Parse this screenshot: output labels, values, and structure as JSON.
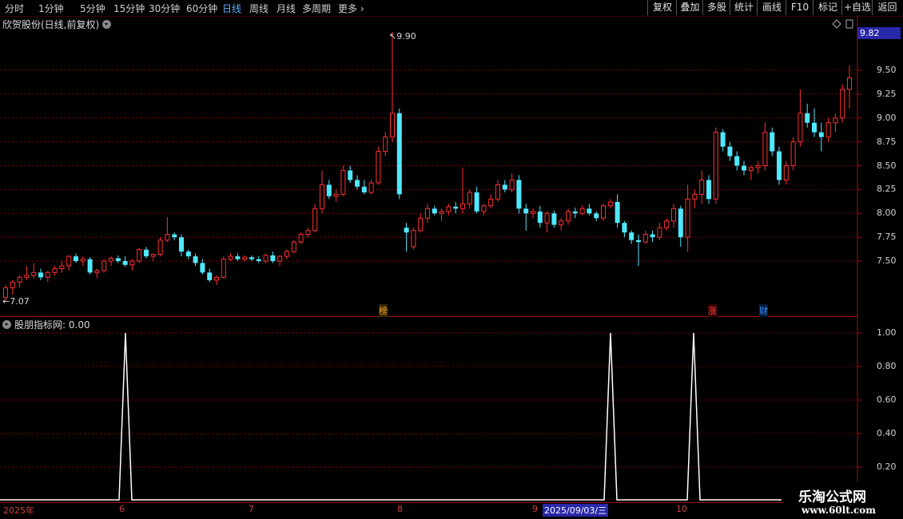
{
  "toolbar": {
    "timeframes": [
      "分时",
      "1分钟",
      "5分钟",
      "15分钟",
      "30分钟",
      "60分钟",
      "日线",
      "周线",
      "月线",
      "多周期",
      "更多"
    ],
    "active_timeframe": "日线",
    "right_buttons": [
      "复权",
      "叠加",
      "多股",
      "统计",
      "画线",
      "F10",
      "标记",
      "+自选",
      "返回"
    ]
  },
  "main_panel": {
    "title": "欣贺股份(日线,前复权)",
    "current_price_tag": "9.82",
    "high_label": "9.90",
    "low_label": "7.07",
    "y_ticks": [
      "9.50",
      "9.25",
      "9.00",
      "8.75",
      "8.50",
      "8.25",
      "8.00",
      "7.75",
      "7.50"
    ],
    "markers": [
      {
        "text": "榜",
        "color": "#e8a030"
      },
      {
        "text": "涨",
        "color": "#ff4040"
      },
      {
        "text": "财",
        "color": "#4090ff"
      }
    ]
  },
  "indicator_panel": {
    "title": "股朋指标网",
    "value_text": ": 0.00",
    "y_ticks": [
      "1.00",
      "0.80",
      "0.60",
      "0.40",
      "0.20"
    ],
    "signals": [
      1,
      0,
      0,
      1,
      1
    ]
  },
  "date_axis": {
    "labels": [
      "2025年",
      "6",
      "7",
      "8",
      "9",
      "10"
    ],
    "cursor_date": "2025/09/03/三"
  },
  "watermark": {
    "line1": "乐淘公式网",
    "line2": "www.60lt.com"
  },
  "colors": {
    "up": "#ff3030",
    "down": "#50e8ff",
    "grid": "#7a0000",
    "axis": "#a01010"
  },
  "chart_data": {
    "type": "candlestick",
    "title": "欣贺股份(日线,前复权)",
    "ylim": [
      7.0,
      10.0
    ],
    "notes": "Daily OHLC values estimated from chart; up = red hollow, down = cyan filled",
    "ohlc": [
      [
        7.12,
        7.25,
        7.07,
        7.22
      ],
      [
        7.22,
        7.3,
        7.15,
        7.28
      ],
      [
        7.28,
        7.35,
        7.22,
        7.33
      ],
      [
        7.33,
        7.45,
        7.3,
        7.35
      ],
      [
        7.35,
        7.48,
        7.32,
        7.38
      ],
      [
        7.38,
        7.42,
        7.3,
        7.33
      ],
      [
        7.33,
        7.4,
        7.28,
        7.38
      ],
      [
        7.38,
        7.45,
        7.35,
        7.42
      ],
      [
        7.42,
        7.5,
        7.38,
        7.45
      ],
      [
        7.45,
        7.56,
        7.4,
        7.55
      ],
      [
        7.55,
        7.58,
        7.48,
        7.5
      ],
      [
        7.5,
        7.55,
        7.45,
        7.52
      ],
      [
        7.52,
        7.54,
        7.36,
        7.38
      ],
      [
        7.38,
        7.42,
        7.32,
        7.4
      ],
      [
        7.4,
        7.52,
        7.38,
        7.5
      ],
      [
        7.5,
        7.55,
        7.45,
        7.53
      ],
      [
        7.53,
        7.56,
        7.48,
        7.5
      ],
      [
        7.5,
        7.55,
        7.44,
        7.46
      ],
      [
        7.46,
        7.52,
        7.4,
        7.5
      ],
      [
        7.5,
        7.64,
        7.48,
        7.62
      ],
      [
        7.62,
        7.65,
        7.53,
        7.55
      ],
      [
        7.55,
        7.58,
        7.5,
        7.57
      ],
      [
        7.57,
        7.75,
        7.55,
        7.72
      ],
      [
        7.72,
        7.96,
        7.7,
        7.78
      ],
      [
        7.78,
        7.8,
        7.72,
        7.75
      ],
      [
        7.75,
        7.78,
        7.55,
        7.6
      ],
      [
        7.6,
        7.62,
        7.52,
        7.55
      ],
      [
        7.55,
        7.58,
        7.45,
        7.48
      ],
      [
        7.48,
        7.52,
        7.36,
        7.38
      ],
      [
        7.38,
        7.42,
        7.28,
        7.3
      ],
      [
        7.3,
        7.35,
        7.25,
        7.33
      ],
      [
        7.33,
        7.55,
        7.32,
        7.52
      ],
      [
        7.52,
        7.58,
        7.5,
        7.55
      ],
      [
        7.55,
        7.58,
        7.5,
        7.52
      ],
      [
        7.52,
        7.56,
        7.5,
        7.54
      ],
      [
        7.54,
        7.56,
        7.5,
        7.52
      ],
      [
        7.52,
        7.55,
        7.48,
        7.5
      ],
      [
        7.5,
        7.58,
        7.48,
        7.56
      ],
      [
        7.56,
        7.6,
        7.48,
        7.5
      ],
      [
        7.5,
        7.56,
        7.45,
        7.55
      ],
      [
        7.55,
        7.62,
        7.52,
        7.6
      ],
      [
        7.6,
        7.72,
        7.58,
        7.7
      ],
      [
        7.7,
        7.8,
        7.68,
        7.78
      ],
      [
        7.78,
        7.85,
        7.75,
        7.82
      ],
      [
        7.82,
        8.1,
        7.8,
        8.05
      ],
      [
        8.05,
        8.45,
        8.0,
        8.3
      ],
      [
        8.3,
        8.35,
        8.15,
        8.18
      ],
      [
        8.18,
        8.25,
        8.12,
        8.2
      ],
      [
        8.2,
        8.5,
        8.18,
        8.45
      ],
      [
        8.45,
        8.5,
        8.32,
        8.35
      ],
      [
        8.35,
        8.4,
        8.25,
        8.28
      ],
      [
        8.28,
        8.35,
        8.2,
        8.22
      ],
      [
        8.22,
        8.35,
        8.2,
        8.32
      ],
      [
        8.32,
        8.7,
        8.3,
        8.65
      ],
      [
        8.65,
        8.85,
        8.6,
        8.8
      ],
      [
        8.8,
        9.9,
        8.75,
        9.05
      ],
      [
        9.05,
        9.1,
        8.15,
        8.2
      ],
      [
        7.85,
        7.9,
        7.6,
        7.8
      ],
      [
        7.65,
        7.85,
        7.62,
        7.82
      ],
      [
        7.82,
        8.0,
        7.8,
        7.95
      ],
      [
        7.95,
        8.1,
        7.9,
        8.05
      ],
      [
        8.05,
        8.08,
        7.98,
        8.0
      ],
      [
        8.0,
        8.05,
        7.92,
        8.02
      ],
      [
        8.02,
        8.1,
        7.98,
        8.07
      ],
      [
        8.07,
        8.12,
        8.0,
        8.05
      ],
      [
        8.05,
        8.48,
        8.0,
        8.1
      ],
      [
        8.1,
        8.25,
        8.05,
        8.22
      ],
      [
        8.22,
        8.28,
        8.0,
        8.02
      ],
      [
        8.02,
        8.1,
        7.98,
        8.08
      ],
      [
        8.08,
        8.2,
        8.05,
        8.15
      ],
      [
        8.15,
        8.35,
        8.12,
        8.3
      ],
      [
        8.3,
        8.35,
        8.22,
        8.25
      ],
      [
        8.25,
        8.42,
        8.22,
        8.35
      ],
      [
        8.35,
        8.4,
        8.0,
        8.05
      ],
      [
        8.05,
        8.1,
        7.82,
        8.0
      ],
      [
        8.0,
        8.05,
        7.95,
        8.02
      ],
      [
        8.02,
        8.08,
        7.85,
        7.9
      ],
      [
        7.9,
        8.02,
        7.8,
        8.0
      ],
      [
        8.0,
        8.03,
        7.85,
        7.88
      ],
      [
        7.88,
        7.95,
        7.82,
        7.92
      ],
      [
        7.92,
        8.05,
        7.88,
        8.02
      ],
      [
        8.02,
        8.06,
        7.95,
        8.0
      ],
      [
        8.0,
        8.08,
        7.98,
        8.05
      ],
      [
        8.05,
        8.1,
        7.98,
        8.0
      ],
      [
        8.0,
        8.02,
        7.92,
        7.95
      ],
      [
        7.95,
        8.1,
        7.92,
        8.08
      ],
      [
        8.08,
        8.15,
        8.05,
        8.12
      ],
      [
        8.12,
        8.2,
        7.85,
        7.9
      ],
      [
        7.9,
        7.92,
        7.75,
        7.8
      ],
      [
        7.8,
        7.82,
        7.68,
        7.72
      ],
      [
        7.72,
        7.78,
        7.45,
        7.7
      ],
      [
        7.7,
        7.82,
        7.68,
        7.78
      ],
      [
        7.78,
        7.82,
        7.7,
        7.75
      ],
      [
        7.75,
        7.9,
        7.72,
        7.85
      ],
      [
        7.85,
        7.95,
        7.82,
        7.92
      ],
      [
        7.92,
        8.1,
        7.85,
        8.05
      ],
      [
        8.05,
        8.08,
        7.65,
        7.75
      ],
      [
        7.75,
        8.3,
        7.6,
        8.15
      ],
      [
        8.15,
        8.25,
        8.05,
        8.2
      ],
      [
        8.2,
        8.45,
        8.1,
        8.35
      ],
      [
        8.35,
        8.4,
        8.1,
        8.15
      ],
      [
        8.15,
        8.9,
        8.1,
        8.85
      ],
      [
        8.85,
        8.88,
        8.65,
        8.7
      ],
      [
        8.7,
        8.75,
        8.55,
        8.6
      ],
      [
        8.6,
        8.65,
        8.45,
        8.5
      ],
      [
        8.5,
        8.55,
        8.4,
        8.45
      ],
      [
        8.45,
        8.5,
        8.35,
        8.48
      ],
      [
        8.48,
        8.55,
        8.42,
        8.5
      ],
      [
        8.5,
        8.95,
        8.45,
        8.85
      ],
      [
        8.85,
        8.9,
        8.6,
        8.65
      ],
      [
        8.65,
        8.7,
        8.3,
        8.35
      ],
      [
        8.35,
        8.55,
        8.3,
        8.5
      ],
      [
        8.5,
        8.8,
        8.45,
        8.75
      ],
      [
        8.75,
        9.3,
        8.7,
        9.05
      ],
      [
        9.05,
        9.15,
        8.9,
        8.95
      ],
      [
        8.95,
        9.1,
        8.8,
        8.85
      ],
      [
        8.85,
        8.95,
        8.65,
        8.8
      ],
      [
        8.8,
        9.0,
        8.75,
        8.95
      ],
      [
        8.95,
        9.05,
        8.85,
        9.0
      ],
      [
        9.0,
        9.35,
        8.95,
        9.3
      ],
      [
        9.3,
        9.55,
        9.1,
        9.42
      ]
    ]
  }
}
